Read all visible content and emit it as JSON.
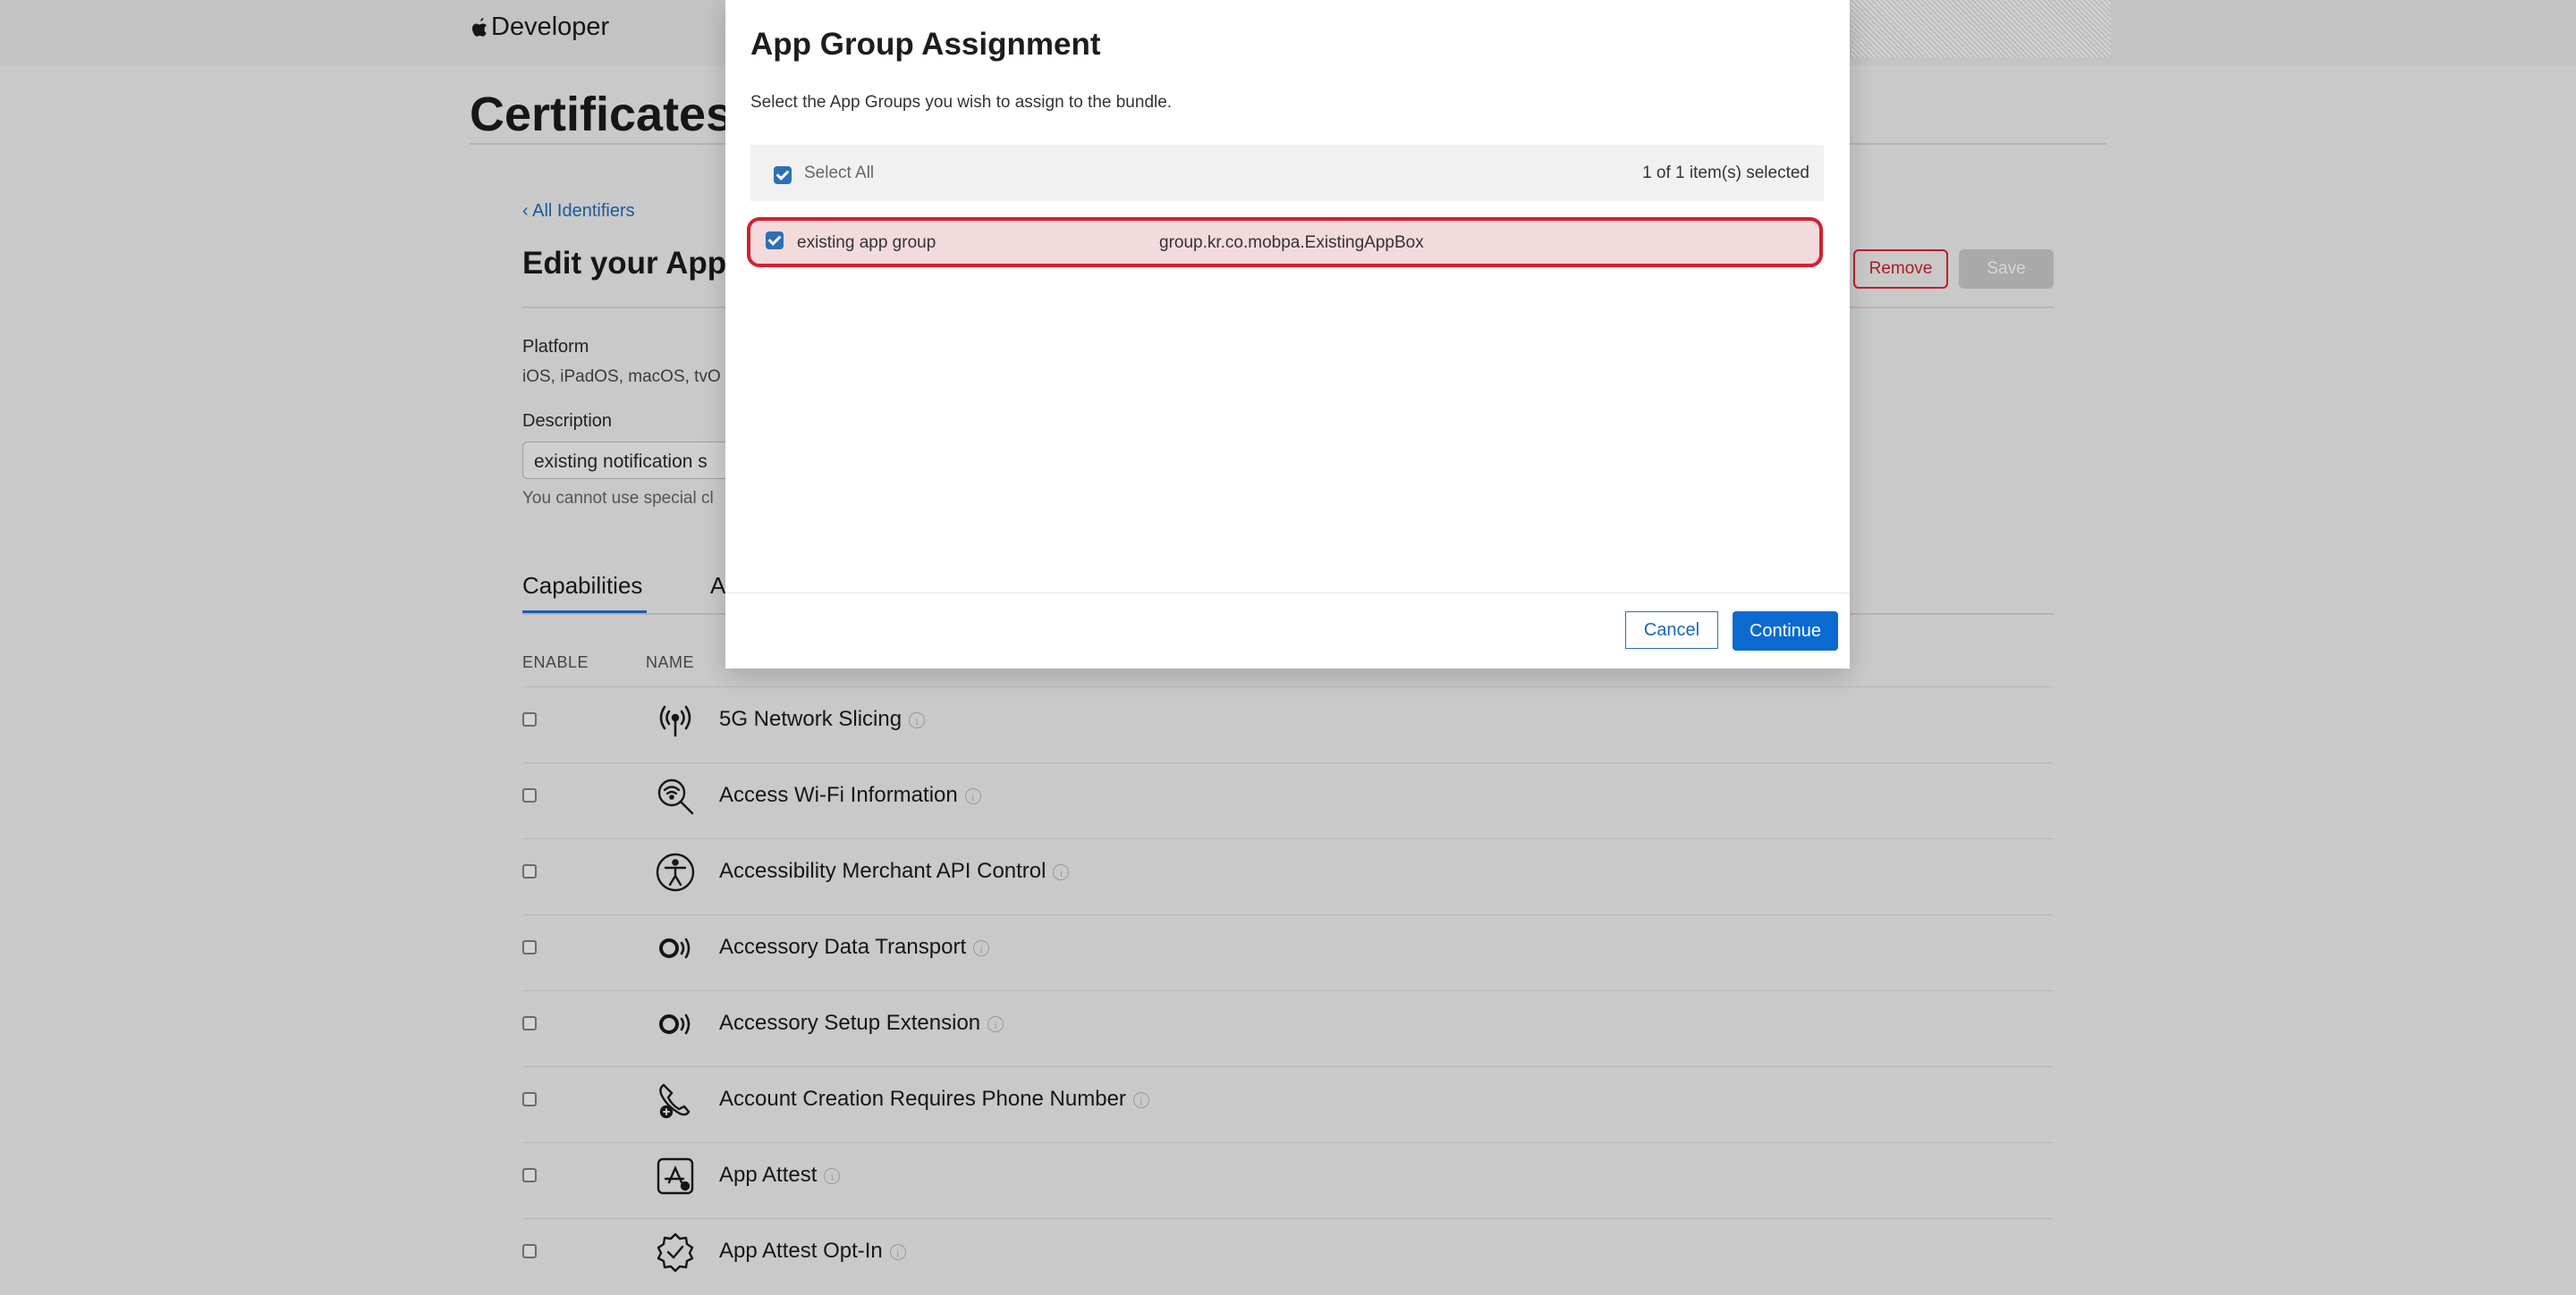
{
  "header": {
    "brand": "Developer"
  },
  "page": {
    "title": "Certificates",
    "back_link": "‹ All Identifiers",
    "edit_title": "Edit your App",
    "remove_label": "Remove",
    "save_label": "Save",
    "platform_label": "Platform",
    "platform_value": "iOS, iPadOS, macOS, tvO",
    "description_label": "Description",
    "description_value": "existing notification s",
    "description_hint": "You cannot use special cl",
    "tabs": [
      {
        "label": "Capabilities"
      },
      {
        "label": "A"
      }
    ],
    "columns": {
      "enable": "ENABLE",
      "name": "NAME"
    },
    "capabilities": [
      {
        "name": "5G Network Slicing",
        "icon": "antenna-icon"
      },
      {
        "name": "Access Wi-Fi Information",
        "icon": "wifi-search-icon"
      },
      {
        "name": "Accessibility Merchant API Control",
        "icon": "accessibility-icon"
      },
      {
        "name": "Accessory Data Transport",
        "icon": "accessory-icon"
      },
      {
        "name": "Accessory Setup Extension",
        "icon": "accessory-icon"
      },
      {
        "name": "Account Creation Requires Phone Number",
        "icon": "phone-number-icon"
      },
      {
        "name": "App Attest",
        "icon": "app-attest-icon"
      },
      {
        "name": "App Attest Opt-In",
        "icon": "badge-check-icon"
      }
    ]
  },
  "modal": {
    "title": "App Group Assignment",
    "subtitle": "Select the App Groups you wish to assign to the bundle.",
    "select_all": "Select All",
    "selected_count": "1 of 1 item(s) selected",
    "items": [
      {
        "name": "existing app group",
        "identifier": "group.kr.co.mobpa.ExistingAppBox",
        "checked": true
      }
    ],
    "cancel_label": "Cancel",
    "continue_label": "Continue"
  },
  "colors": {
    "accent": "#0b6ad0",
    "highlight_border": "#d32030",
    "highlight_fill": "#f3dadd"
  }
}
